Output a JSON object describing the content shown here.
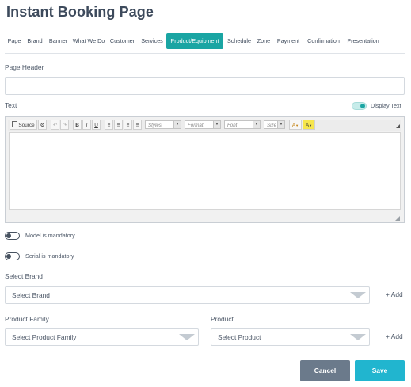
{
  "page": {
    "title": "Instant Booking Page"
  },
  "tabs": [
    {
      "label": "Page",
      "active": false
    },
    {
      "label": "Brand",
      "active": false
    },
    {
      "label": "Banner",
      "active": false
    },
    {
      "label": "What We Do",
      "active": false
    },
    {
      "label": "Customer",
      "active": false
    },
    {
      "label": "Services",
      "active": false
    },
    {
      "label": "Product/Equipment",
      "active": true
    },
    {
      "label": "Schedule",
      "active": false
    },
    {
      "label": "Zone",
      "active": false
    },
    {
      "label": "Payment",
      "active": false
    },
    {
      "label": "Confirmation",
      "active": false
    },
    {
      "label": "Presentation",
      "active": false
    }
  ],
  "page_header": {
    "label": "Page Header",
    "value": ""
  },
  "text": {
    "label": "Text",
    "display_toggle_label": "Display Text",
    "display_toggle_on": true
  },
  "editor": {
    "source_label": "Source",
    "styles_label": "Styles",
    "format_label": "Format",
    "font_label": "Font",
    "size_label": "Size",
    "bold": "B",
    "italic": "I",
    "underline": "U",
    "text_color": "A",
    "bg_color": "A",
    "content": ""
  },
  "toggles": {
    "model_mandatory": {
      "label": "Model is mandatory",
      "on": false
    },
    "serial_mandatory": {
      "label": "Serial is mandatory",
      "on": false
    }
  },
  "brand": {
    "label": "Select Brand",
    "placeholder": "Select Brand",
    "add_label": "+ Add"
  },
  "product_family": {
    "label": "Product Family",
    "placeholder": "Select Product Family"
  },
  "product": {
    "label": "Product",
    "placeholder": "Select Product",
    "add_label": "+ Add"
  },
  "actions": {
    "cancel_label": "Cancel",
    "save_label": "Save"
  },
  "colors": {
    "accent": "#1aa5a3",
    "save": "#21b5cf",
    "cancel": "#6b7a8b"
  }
}
